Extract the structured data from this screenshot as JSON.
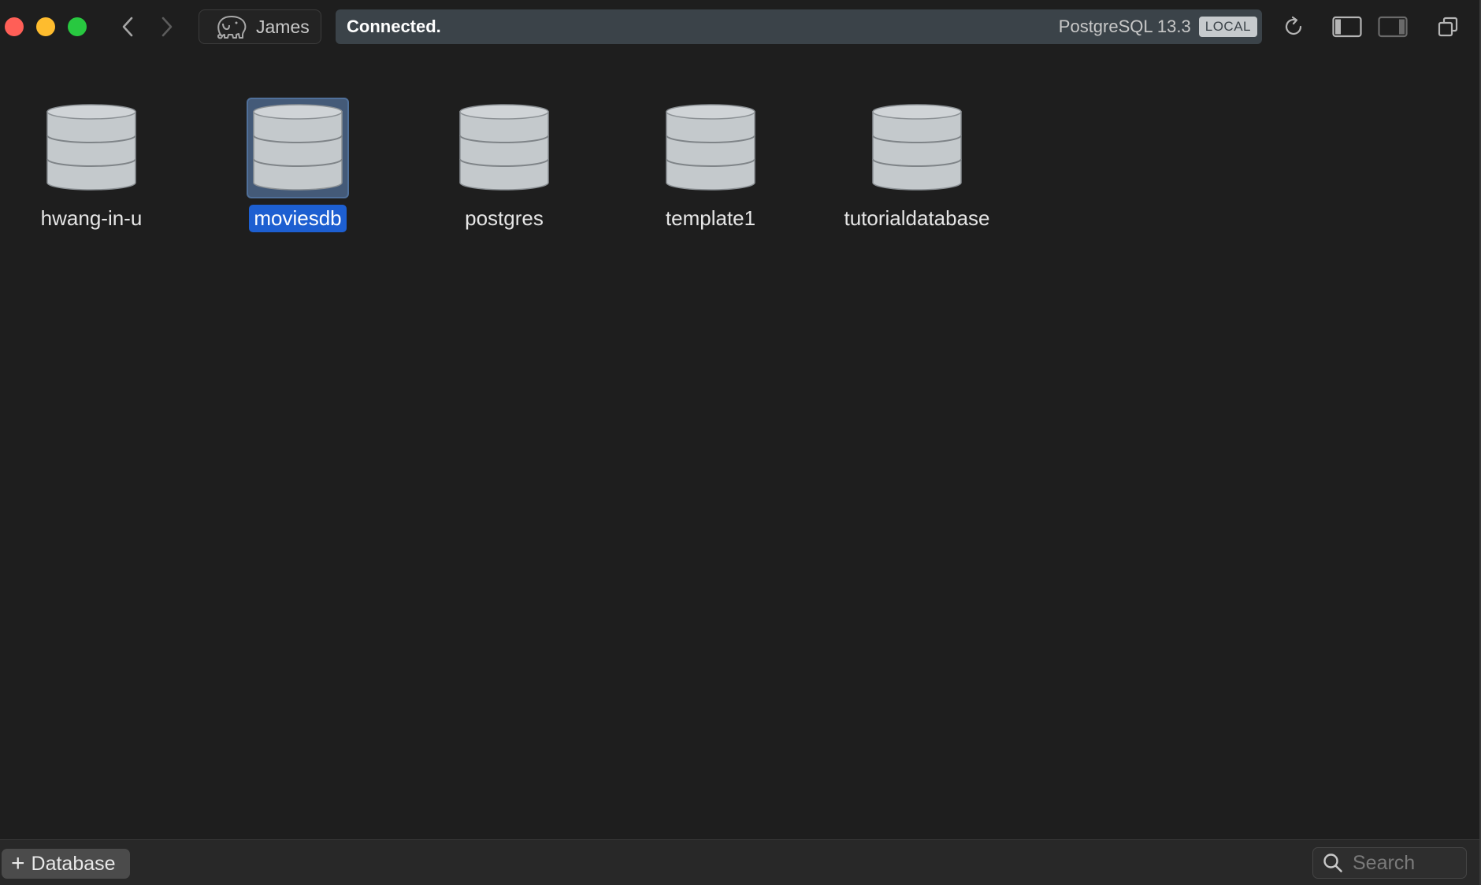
{
  "toolbar": {
    "server_name": "James",
    "status_text": "Connected.",
    "server_version": "PostgreSQL 13.3",
    "environment_badge": "LOCAL"
  },
  "icons": {
    "back": "chevron-left-icon",
    "forward": "chevron-right-icon",
    "server": "elephant-icon",
    "refresh": "refresh-icon",
    "left_panel": "left-sidebar-icon",
    "right_panel": "right-sidebar-icon",
    "windows": "windows-icon",
    "database": "database-icon",
    "search": "search-icon"
  },
  "databases": [
    {
      "name": "hwang-in-u",
      "selected": false
    },
    {
      "name": "moviesdb",
      "selected": true
    },
    {
      "name": "postgres",
      "selected": false
    },
    {
      "name": "template1",
      "selected": false
    },
    {
      "name": "tutorialdatabase",
      "selected": false
    }
  ],
  "footer": {
    "add_label": "Database",
    "search_placeholder": "Search"
  },
  "colors": {
    "selection_highlight": "#1d5fd1",
    "selected_icon_bg": "#445a78",
    "status_bar_bg": "#3b4349",
    "window_bg": "#1e1e1e"
  }
}
